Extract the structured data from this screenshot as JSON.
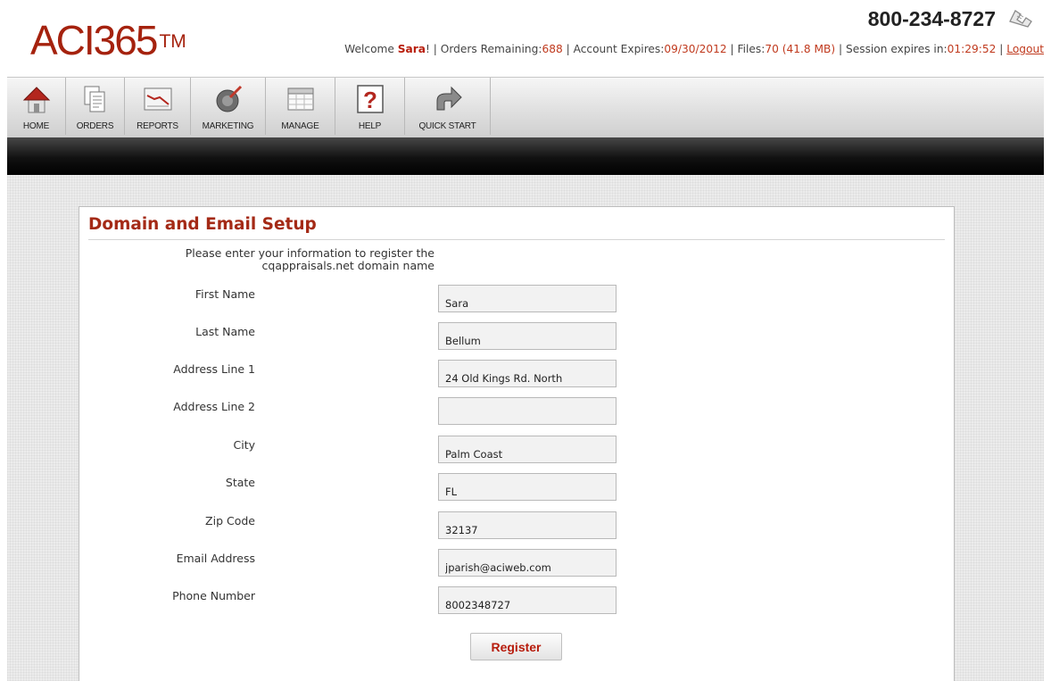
{
  "header": {
    "logo_text": "ACI365",
    "logo_tm": "TM",
    "phone": "800-234-8727",
    "welcome_prefix": "Welcome ",
    "user_name": "Sara",
    "welcome_suffix": "! | Orders Remaining:",
    "orders_remaining": "688",
    "account_expires_label": " | Account Expires:",
    "account_expires": "09/30/2012",
    "files_label": " | Files:",
    "files": "70 (41.8 MB)",
    "session_label": " | Session expires in:",
    "session_expires": "01:29:52",
    "separator": " | ",
    "logout": "Logout"
  },
  "toolbar": {
    "items": [
      {
        "label": "HOME",
        "icon": "home-icon"
      },
      {
        "label": "ORDERS",
        "icon": "orders-icon"
      },
      {
        "label": "REPORTS",
        "icon": "reports-icon"
      },
      {
        "label": "MARKETING",
        "icon": "marketing-icon"
      },
      {
        "label": "MANAGE",
        "icon": "manage-icon"
      },
      {
        "label": "HELP",
        "icon": "help-icon"
      },
      {
        "label": "QUICK START",
        "icon": "quick-start-icon"
      }
    ]
  },
  "form": {
    "title": "Domain and Email Setup",
    "intro_line1": "Please enter your information to register the",
    "intro_line2": "cqappraisals.net domain name",
    "fields": [
      {
        "label": "First Name",
        "value": "Sara"
      },
      {
        "label": "Last Name",
        "value": "Bellum"
      },
      {
        "label": "Address Line 1",
        "value": "24 Old Kings Rd. North"
      },
      {
        "label": "Address Line 2",
        "value": ""
      },
      {
        "label": "City",
        "value": "Palm Coast"
      },
      {
        "label": "State",
        "value": "FL"
      },
      {
        "label": "Zip Code",
        "value": "32137"
      },
      {
        "label": "Email Address",
        "value": "jparish@aciweb.com"
      },
      {
        "label": "Phone Number",
        "value": "8002348727"
      }
    ],
    "register_label": "Register"
  },
  "colors": {
    "brand_red": "#a5220e",
    "value_orange": "#c03a1e",
    "title_red": "#a42a16"
  }
}
